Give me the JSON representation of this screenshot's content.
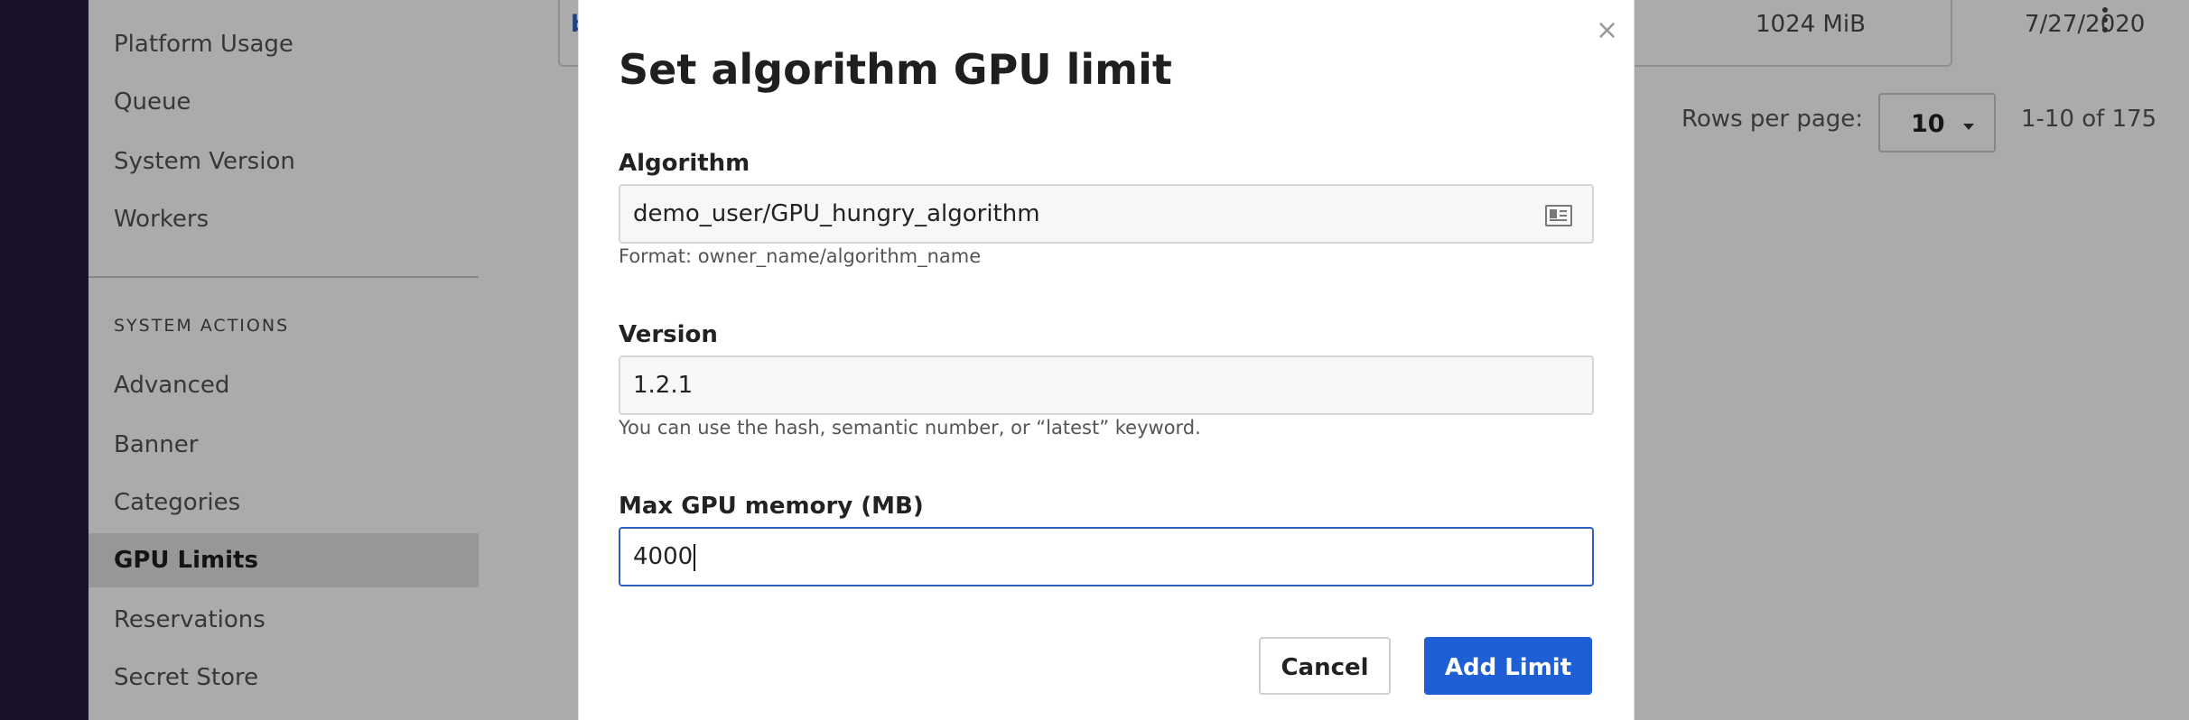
{
  "sidebar": {
    "items_top": [
      {
        "label": "Platform Usage"
      },
      {
        "label": "Queue"
      },
      {
        "label": "System Version"
      },
      {
        "label": "Workers"
      }
    ],
    "section_heading": "SYSTEM ACTIONS",
    "items_actions": [
      {
        "label": "Advanced"
      },
      {
        "label": "Banner"
      },
      {
        "label": "Categories"
      },
      {
        "label": "GPU Limits",
        "active": true
      },
      {
        "label": "Reservations"
      },
      {
        "label": "Secret Store"
      }
    ]
  },
  "table": {
    "visible_row": {
      "link_text": "b",
      "memory": "1024 MiB",
      "date": "7/27/2020"
    }
  },
  "pagination": {
    "rows_per_page_label": "Rows per page:",
    "rows_per_page_value": "10",
    "range_text": "1-10 of 175"
  },
  "modal": {
    "title": "Set algorithm GPU limit",
    "close_label": "×",
    "algorithm": {
      "label": "Algorithm",
      "value": "demo_user/GPU_hungry_algorithm",
      "help": "Format: owner_name/algorithm_name"
    },
    "version": {
      "label": "Version",
      "value": "1.2.1",
      "help": "You can use the hash, semantic number, or “latest” keyword."
    },
    "max_gpu_memory": {
      "label": "Max GPU memory (MB)",
      "value": "4000"
    },
    "cancel_label": "Cancel",
    "submit_label": "Add Limit"
  },
  "colors": {
    "rail": "#2a1a3f",
    "primary": "#1f5fd6",
    "focus_border": "#2f5fc4",
    "active_item_bg": "#dfe1e4"
  },
  "icons": {
    "algorithm_field": "id-card-icon",
    "row_menu": "kebab-menu-icon",
    "pager_caret": "caret-down-icon",
    "close": "close-icon"
  }
}
